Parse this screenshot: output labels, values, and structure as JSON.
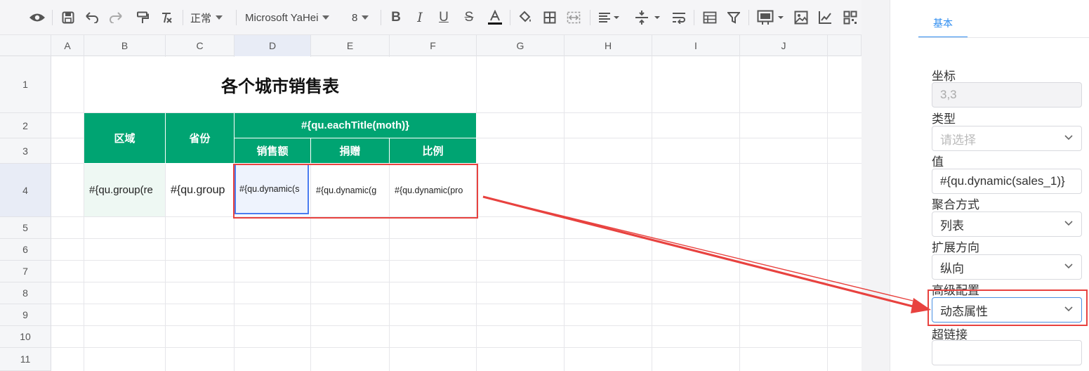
{
  "toolbar": {
    "font_style": "正常",
    "font_family": "Microsoft YaHei",
    "font_size": "8",
    "icons": [
      "preview-icon",
      "save-icon",
      "undo-icon",
      "redo-icon",
      "format-painter-icon",
      "clear-format-icon",
      "bold-icon",
      "italic-icon",
      "underline-icon",
      "strikethrough-icon",
      "font-color-icon",
      "fill-color-icon",
      "border-icon",
      "merge-icon",
      "align-horizontal-icon",
      "align-vertical-icon",
      "wrap-text-icon",
      "table-icon",
      "filter-icon",
      "chart-type-icon",
      "image-icon",
      "line-chart-icon",
      "qrcode-icon"
    ]
  },
  "columns": [
    "A",
    "B",
    "C",
    "D",
    "E",
    "F",
    "G",
    "H",
    "I",
    "J"
  ],
  "rows": [
    "1",
    "2",
    "3",
    "4",
    "5",
    "6",
    "7",
    "8",
    "9",
    "10",
    "11"
  ],
  "cells": {
    "title": "各个城市销售表",
    "h_region": "区域",
    "h_province": "省份",
    "h_each_title": "#{qu.eachTitle(moth)}",
    "h_sales": "销售额",
    "h_donation": "捐赠",
    "h_ratio": "比例",
    "b4": "#{qu.group(re",
    "c4": "#{qu.group",
    "d4": "#{qu.dynamic(s",
    "e4": "#{qu.dynamic(g",
    "f4": "#{qu.dynamic(pro"
  },
  "panel": {
    "tab": "基本",
    "coord_label": "坐标",
    "coord_value": "3,3",
    "type_label": "类型",
    "type_placeholder": "请选择",
    "value_label": "值",
    "value_value": "#{qu.dynamic(sales_1)}",
    "agg_label": "聚合方式",
    "agg_value": "列表",
    "expand_label": "扩展方向",
    "expand_value": "纵向",
    "advanced_label": "高级配置",
    "advanced_value": "动态属性",
    "link_label": "超链接",
    "link_value": ""
  },
  "colors": {
    "header_green": "#00a472",
    "highlight_red": "#e8423f",
    "accent_blue": "#2d8cf0"
  }
}
